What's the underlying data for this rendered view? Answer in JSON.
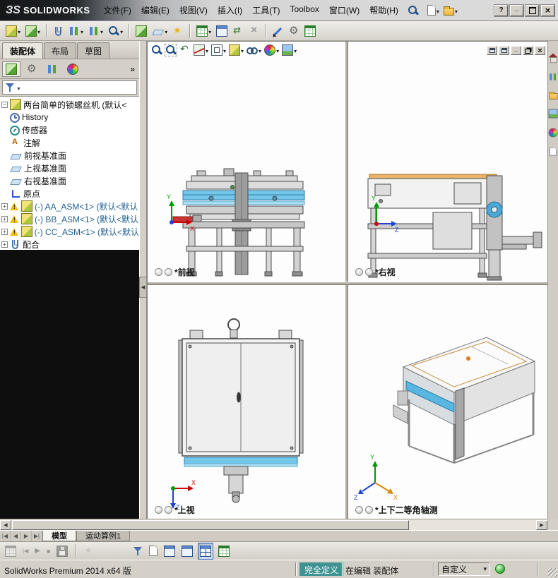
{
  "titlebar": {
    "logo_mark": "ЗS",
    "logo_text": "SOLIDWORKS",
    "menus": [
      "文件(F)",
      "编辑(E)",
      "视图(V)",
      "插入(I)",
      "工具(T)",
      "Toolbox",
      "窗口(W)",
      "帮助(H)"
    ],
    "help": "?"
  },
  "icons": {
    "main_toolbar": [
      "insert-components",
      "edit-component",
      "mate",
      "linear-component-pattern",
      "circular-component-pattern",
      "show-hidden-components",
      "assembly-features",
      "reference-geometry",
      "new-motion-study",
      "bill-of-materials",
      "exploded-view",
      "interference-detection",
      "no-external-references",
      "measure",
      "mass-properties",
      "design-table"
    ],
    "heads_up": [
      "zoom-fit",
      "zoom-area",
      "previous-view",
      "section-view",
      "view-orientation",
      "display-style",
      "hide-show-items",
      "edit-appearance",
      "apply-scene"
    ],
    "feature_tabs": [
      "featuremanager",
      "propertymanager",
      "configurationmanager",
      "appearances"
    ],
    "task_pane": [
      "resources-home",
      "design-library",
      "file-explorer",
      "view-palette",
      "appearances",
      "custom-properties"
    ],
    "motion_bar": [
      "calculate",
      "play-from-start",
      "play",
      "stop",
      "save-animation",
      "animation-wizard",
      "filter",
      "key-properties",
      "viewport-single",
      "viewport-two",
      "viewport-four",
      "excel-table"
    ]
  },
  "command_tabs": [
    "装配体",
    "布局",
    "草图"
  ],
  "feature_panel": {
    "overflow": "»",
    "root": "两台简单的锁螺丝机  (默认<",
    "items": [
      "History",
      "传感器",
      "注解",
      "前视基准面",
      "上视基准面",
      "右视基准面",
      "原点",
      "(-) AA_ASM<1> (默认<默认",
      "(-) BB_ASM<1> (默认<默认",
      "(-) CC_ASM<1> (默认<默认",
      "配合"
    ]
  },
  "viewports": {
    "front": {
      "label": "*前视"
    },
    "right": {
      "label": "*右视"
    },
    "top": {
      "label": "*上视"
    },
    "iso": {
      "label": "*上下二等角轴测"
    },
    "triad": {
      "x": "X",
      "y": "Y",
      "z": "Z"
    }
  },
  "bottom": {
    "tabs": [
      "模型",
      "运动算例1"
    ]
  },
  "status_bar": {
    "product": "SolidWorks Premium 2014 x64 版",
    "defined": "完全定义",
    "editing": "在编辑  装配体",
    "custom": "自定义"
  },
  "colors": {
    "rail_blue": "#6ec6e8",
    "accent_orange": "#e0953f",
    "status_defined_bg": "#3f9393",
    "warning_yellow": "#f0c010"
  }
}
